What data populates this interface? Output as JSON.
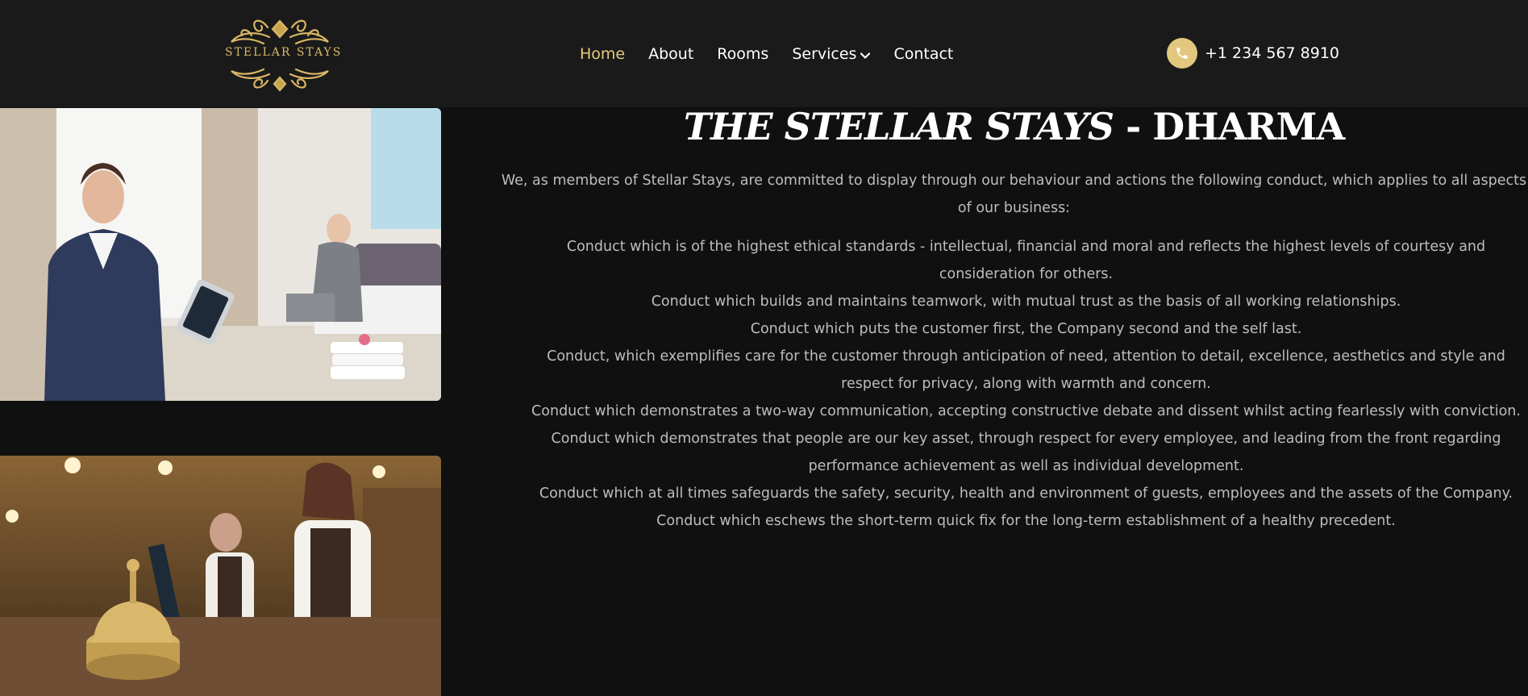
{
  "brand": {
    "name": "STELLAR STAYS",
    "accent_color": "#e2c77f"
  },
  "nav": {
    "items": [
      {
        "label": "Home",
        "active": true
      },
      {
        "label": "About"
      },
      {
        "label": "Rooms"
      },
      {
        "label": "Services",
        "has_dropdown": true
      },
      {
        "label": "Contact"
      }
    ]
  },
  "header": {
    "phone": "+1 234 567 8910",
    "phone_icon": "phone-icon"
  },
  "main": {
    "title_italic": "THE STELLAR STAYS",
    "title_rest": " - DHARMA",
    "intro": "We, as members of Stellar Stays, are committed to display through our behaviour and actions the following conduct, which applies to all aspects of our business:",
    "conduct": [
      "Conduct which is of the highest ethical standards - intellectual, financial and moral and reflects the highest levels of courtesy and consideration for others.",
      "Conduct which builds and maintains teamwork, with mutual trust as the basis of all working relationships.",
      "Conduct which puts the customer first, the Company second and the self last.",
      "Conduct, which exemplifies care for the customer through anticipation of need, attention to detail, excellence, aesthetics and style and respect for privacy, along with warmth and concern.",
      "Conduct which demonstrates a two-way communication, accepting constructive debate and dissent whilst acting fearlessly with conviction.",
      "Conduct which demonstrates that people are our key asset, through respect for every employee, and leading from the front regarding performance achievement as well as individual development.",
      "Conduct which at all times safeguards the safety, security, health and environment of guests, employees and the assets of the Company.",
      "Conduct which eschews the short-term quick fix for the long-term establishment of a healthy precedent."
    ]
  },
  "images": {
    "photo1": "hotel-staff-with-tablet-and-housekeeper-photo",
    "photo2": "reception-desk-bell-photo"
  }
}
